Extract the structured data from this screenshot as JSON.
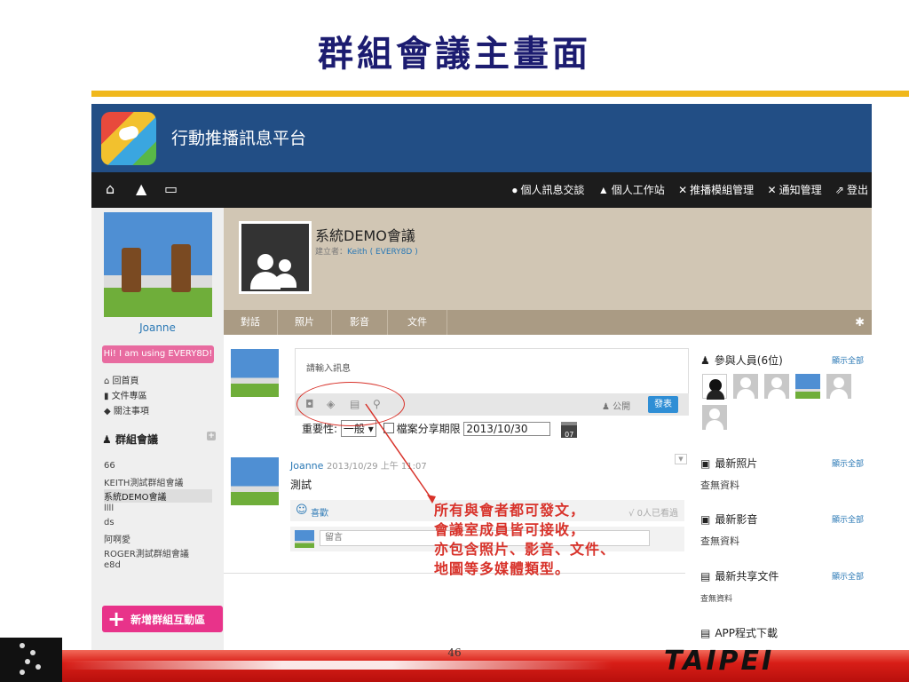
{
  "slide": {
    "title": "群組會議主畫面",
    "page_number": "46",
    "brand": "TAIPEI"
  },
  "app": {
    "title": "行動推播訊息平台"
  },
  "navbar": {
    "left_icons": [
      "home-icon",
      "alert-icon",
      "chat-bubble-icon"
    ],
    "items": [
      {
        "label": "個人訊息交談",
        "icon": "chat-icon"
      },
      {
        "label": "個人工作站",
        "icon": "person-icon"
      },
      {
        "label": "推播模組管理",
        "icon": "tools-icon"
      },
      {
        "label": "通知管理",
        "icon": "tools-icon"
      },
      {
        "label": "登出",
        "icon": "logout-icon"
      }
    ]
  },
  "sidebar": {
    "user_name": "Joanne",
    "status": "Hi! I am using EVERY8D!",
    "links": [
      "回首頁",
      "文件專區",
      "關注事項"
    ],
    "section_title": "群組會議",
    "groups": [
      "66",
      "KEITH測試群組會議",
      "系統DEMO會議",
      "llll",
      "ds",
      "阿啊愛",
      "ROGER測試群組會議",
      "e8d"
    ],
    "active_group": "系統DEMO會議",
    "new_group_label": "新增群組互動區"
  },
  "group": {
    "name": "系統DEMO會議",
    "creator_label": "建立者：",
    "creator": "Keith ( EVERY8D )",
    "tabs": [
      "對話",
      "照片",
      "影音",
      "文件"
    ]
  },
  "composer": {
    "placeholder": "請輸入訊息",
    "public_label": "公開",
    "post_label": "發表",
    "importance_label": "重要性:",
    "importance_value": "一般",
    "share_label": "檔案分享期限",
    "share_date": "2013/10/30",
    "calendar_day": "07"
  },
  "post": {
    "author": "Joanne",
    "timestamp": "2013/10/29 上午 11:07",
    "body": "測試",
    "like_label": "喜歡",
    "seen_label": "√ 0人已看過",
    "comment_placeholder": "留言"
  },
  "right_panel": {
    "participants_title": "參與人員(6位)",
    "show_all": "顯示全部",
    "photos_title": "最新照片",
    "videos_title": "最新影音",
    "docs_title": "最新共享文件",
    "empty_text": "查無資料",
    "app_download": "APP程式下載"
  },
  "annotation": {
    "lines": [
      "所有與會者都可發文，",
      "會議室成員皆可接收，",
      "亦包含照片、影音、文件、",
      "地圖等多媒體類型。"
    ]
  },
  "colors": {
    "title": "#1c1c70",
    "accent_rule": "#f0b81c",
    "topbar": "#224e85",
    "annotation": "#d8322a",
    "pink": "#e8338a",
    "link": "#2a78b5"
  }
}
